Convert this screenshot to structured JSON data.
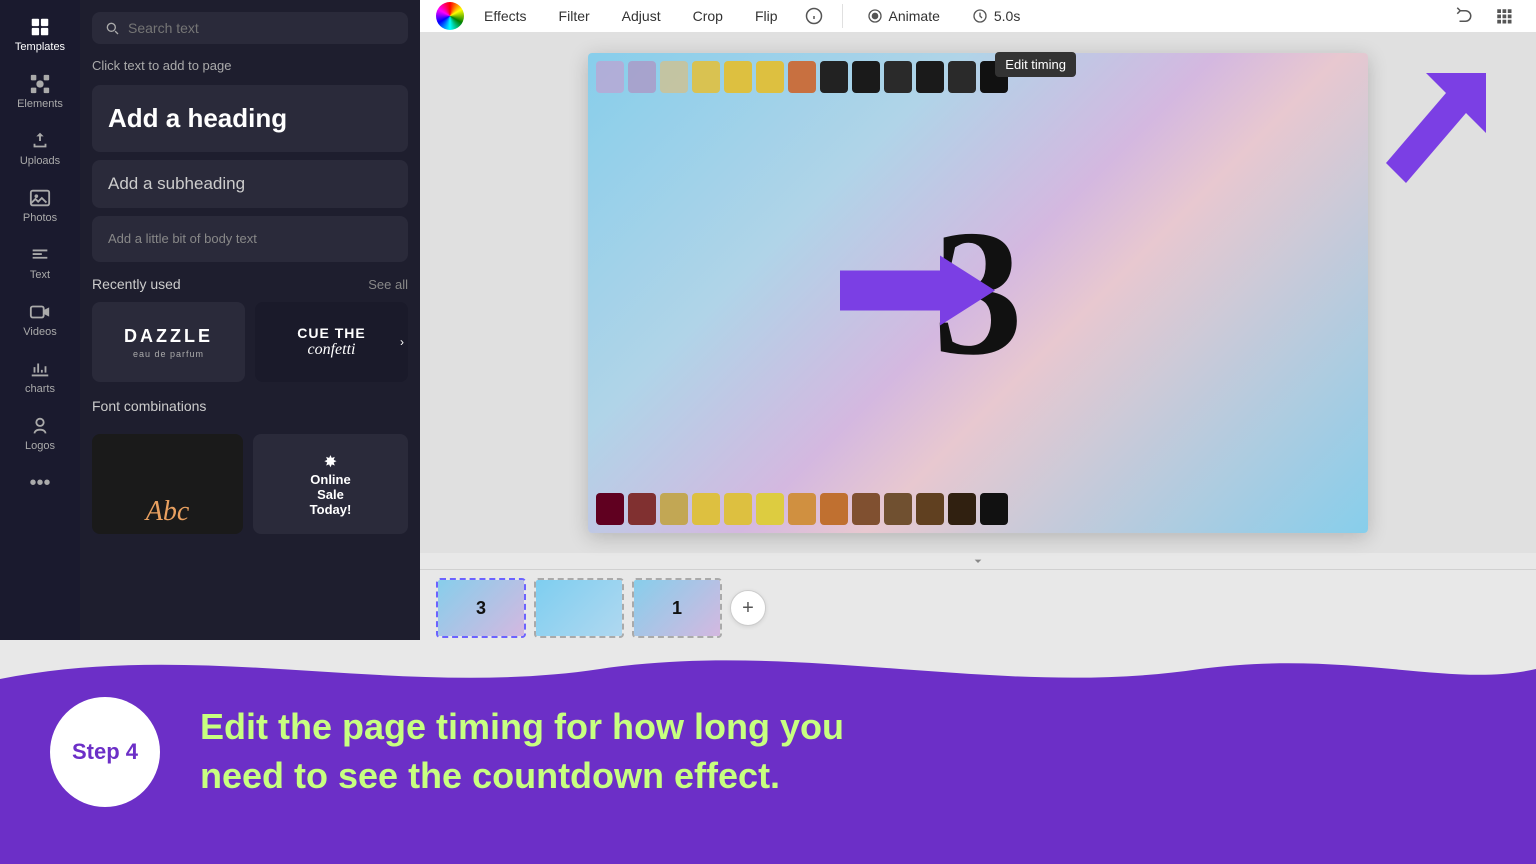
{
  "toolbar": {
    "effects_label": "Effects",
    "filter_label": "Filter",
    "adjust_label": "Adjust",
    "crop_label": "Crop",
    "flip_label": "Flip",
    "animate_label": "Animate",
    "timing_value": "5.0s",
    "edit_timing_tooltip": "Edit timing"
  },
  "sidebar": {
    "items": [
      {
        "id": "templates",
        "label": "Templates",
        "active": true
      },
      {
        "id": "elements",
        "label": "Elements"
      },
      {
        "id": "uploads",
        "label": "Uploads"
      },
      {
        "id": "photos",
        "label": "Photos"
      },
      {
        "id": "text",
        "label": "Text"
      },
      {
        "id": "videos",
        "label": "Videos"
      },
      {
        "id": "charts",
        "label": "charts"
      },
      {
        "id": "logos",
        "label": "Logos"
      },
      {
        "id": "more",
        "label": "..."
      }
    ]
  },
  "text_panel": {
    "search_placeholder": "Search text",
    "click_hint": "Click text to add to page",
    "heading_label": "Add a heading",
    "subheading_label": "Add a subheading",
    "body_label": "Add a little bit of body text",
    "recently_used_label": "Recently used",
    "see_all_label": "See all",
    "font_combinations_label": "Font combinations",
    "dazzle_text": "DAZZLE",
    "dazzle_sub": "eau de parfum",
    "confetti_main": "CUE THE",
    "confetti_script": "confetti",
    "online_sale_main": "Online",
    "online_sale_sub": "Sale",
    "online_sale_today": "Today!"
  },
  "canvas": {
    "big_number": "3"
  },
  "thumbnails": [
    {
      "id": 1,
      "number": "3",
      "active": true
    },
    {
      "id": 2,
      "number": "",
      "active": false
    },
    {
      "id": 3,
      "number": "1",
      "active": false
    }
  ],
  "bottom": {
    "step_label": "Step 4",
    "instruction_line1": "Edit the page timing for how long you",
    "instruction_line2": "need to see the countdown effect."
  },
  "colors": {
    "purple_accent": "#6c2fc7",
    "purple_arrow": "#7b3fe4",
    "green_text": "#c8ff80"
  }
}
